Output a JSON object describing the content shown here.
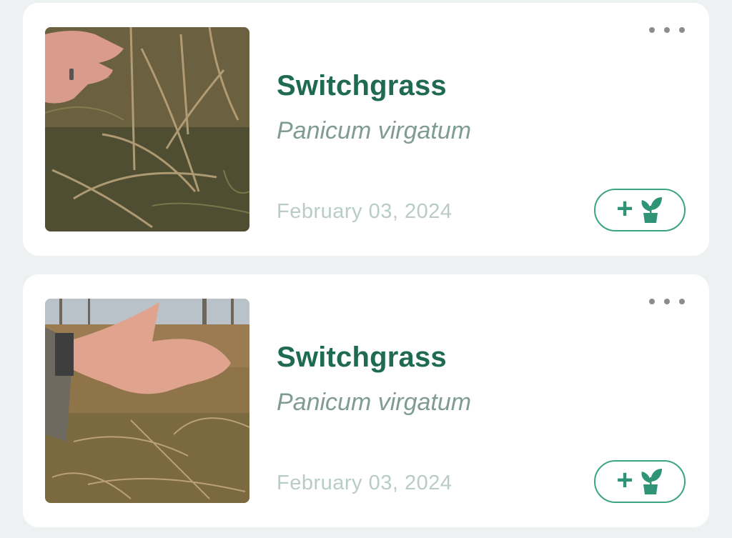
{
  "colors": {
    "card_bg": "#ffffff",
    "page_bg": "#eef1f1",
    "common_name": "#1f6a52",
    "scientific_name": "#7f9b92",
    "date": "#b9ccc6",
    "accent": "#3aa483"
  },
  "items": [
    {
      "common_name": "Switchgrass",
      "scientific_name": "Panicum virgatum",
      "date": "February 03, 2024",
      "add_button_icons": [
        "plus-icon",
        "potted-plant-icon"
      ],
      "menu_icon": "more-horizontal-icon"
    },
    {
      "common_name": "Switchgrass",
      "scientific_name": "Panicum virgatum",
      "date": "February 03, 2024",
      "add_button_icons": [
        "plus-icon",
        "potted-plant-icon"
      ],
      "menu_icon": "more-horizontal-icon"
    }
  ]
}
